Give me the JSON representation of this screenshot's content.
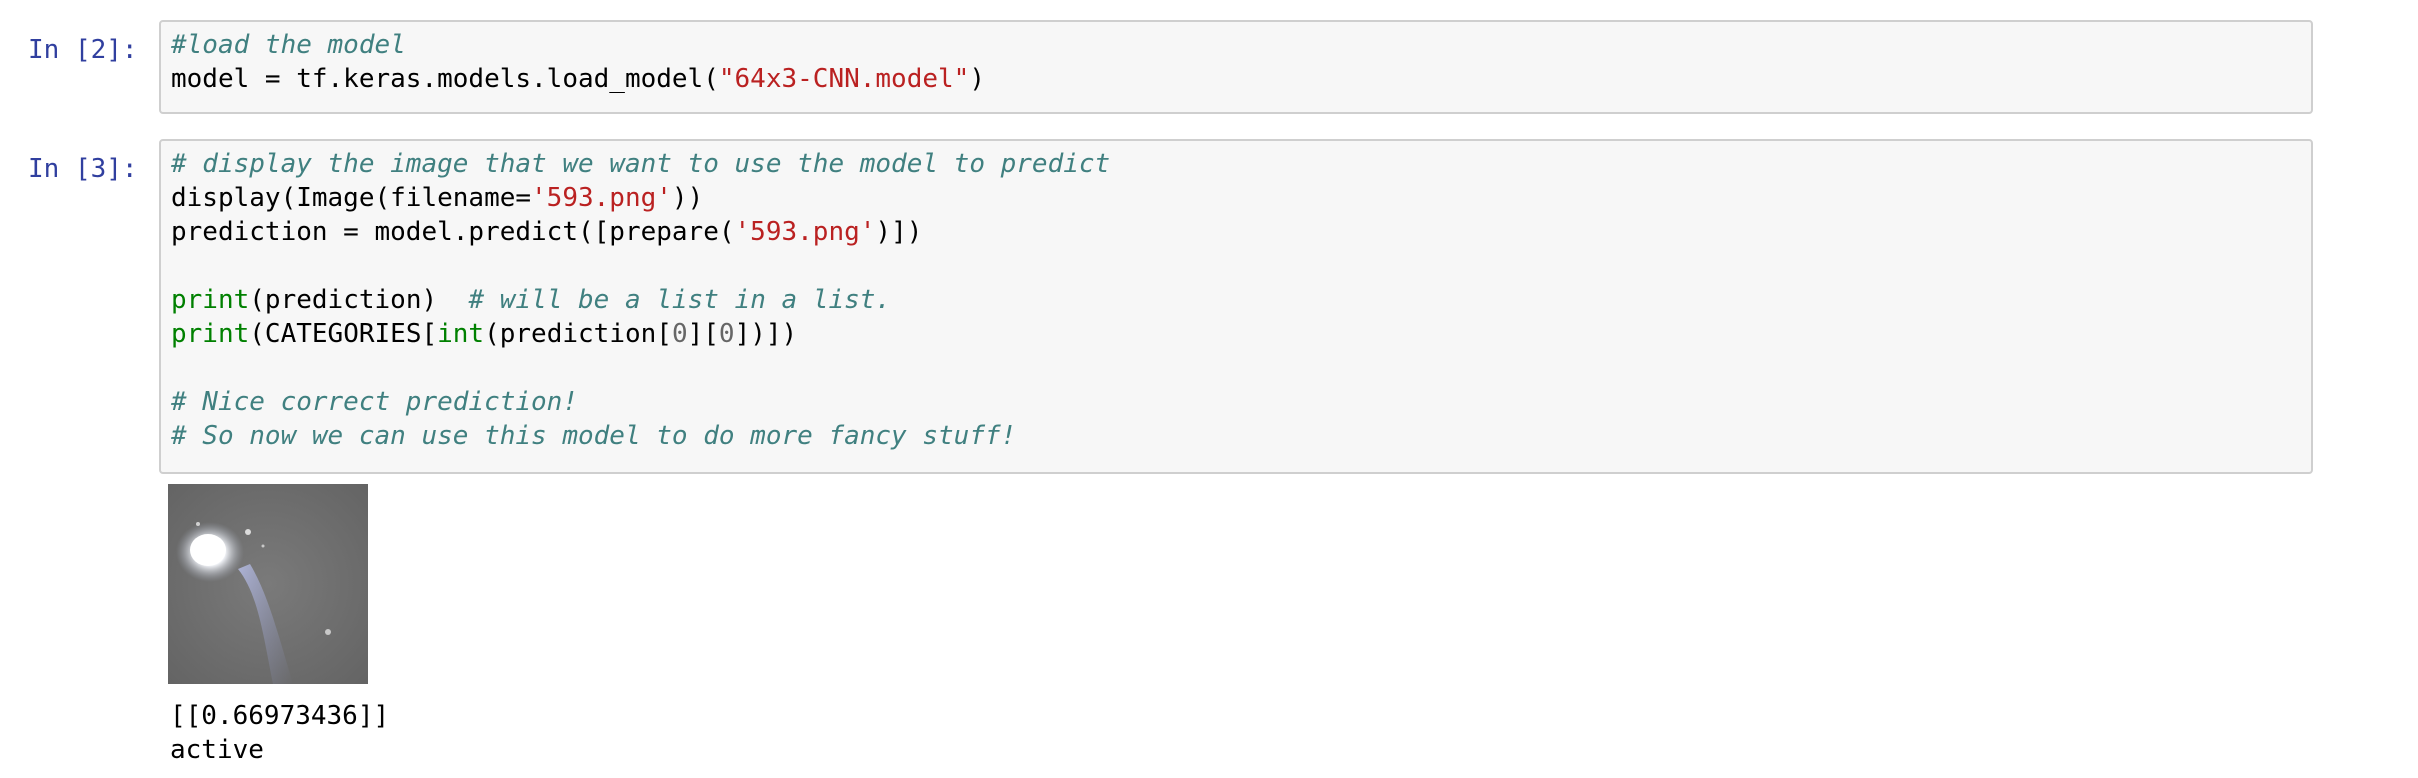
{
  "cells": [
    {
      "prompt": "In [2]:",
      "lines": [
        [
          {
            "t": "#load the model",
            "c": "cm"
          }
        ],
        [
          {
            "t": "model = tf.keras.models.load_model(",
            "c": ""
          },
          {
            "t": "\"64x3-CNN.model\"",
            "c": "str"
          },
          {
            "t": ")",
            "c": ""
          }
        ]
      ]
    },
    {
      "prompt": "In [3]:",
      "lines": [
        [
          {
            "t": "# display the image that we want to use the model to predict",
            "c": "cm"
          }
        ],
        [
          {
            "t": "display(Image(filename=",
            "c": ""
          },
          {
            "t": "'593.png'",
            "c": "str"
          },
          {
            "t": "))",
            "c": ""
          }
        ],
        [
          {
            "t": "prediction = model.predict([prepare(",
            "c": ""
          },
          {
            "t": "'593.png'",
            "c": "str"
          },
          {
            "t": ")])",
            "c": ""
          }
        ],
        [],
        [
          {
            "t": "print",
            "c": "bi"
          },
          {
            "t": "(prediction)  ",
            "c": ""
          },
          {
            "t": "# will be a list in a list.",
            "c": "cm"
          }
        ],
        [
          {
            "t": "print",
            "c": "bi"
          },
          {
            "t": "(CATEGORIES[",
            "c": ""
          },
          {
            "t": "int",
            "c": "bi"
          },
          {
            "t": "(prediction[",
            "c": ""
          },
          {
            "t": "0",
            "c": "num"
          },
          {
            "t": "][",
            "c": ""
          },
          {
            "t": "0",
            "c": "num"
          },
          {
            "t": "])])",
            "c": ""
          }
        ],
        [],
        [
          {
            "t": "# Nice correct prediction!",
            "c": "cm"
          }
        ],
        [
          {
            "t": "# So now we can use this model to do more fancy stuff!",
            "c": "cm"
          }
        ]
      ]
    }
  ],
  "output": {
    "image_name": "output-image-593",
    "prediction_text": "[[0.66973436]]",
    "category_text": "active"
  }
}
